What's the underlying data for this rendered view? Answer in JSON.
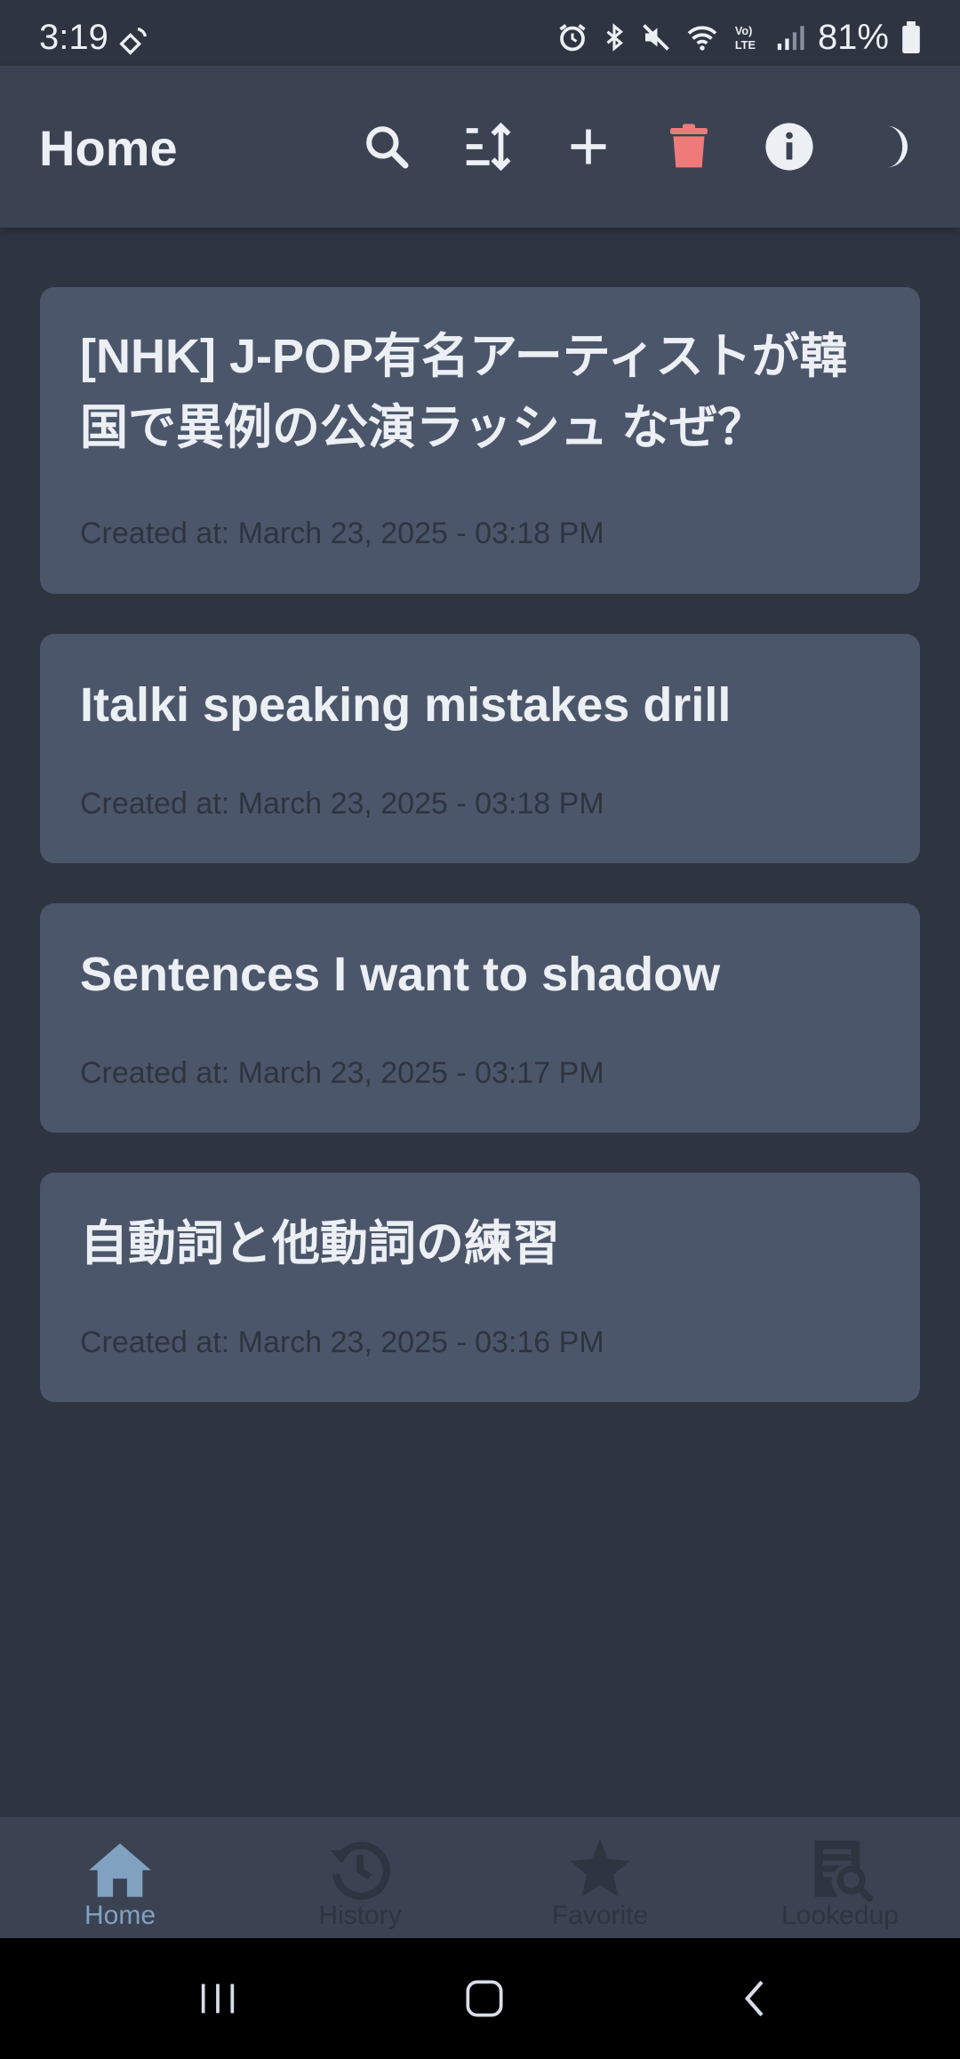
{
  "status_bar": {
    "time": "3:19",
    "battery": "81%",
    "icons": [
      "satellite-icon",
      "alarm-icon",
      "bluetooth-icon",
      "mute-icon",
      "wifi-icon",
      "volte-icon",
      "signal-icon",
      "battery-icon"
    ]
  },
  "app_bar": {
    "title": "Home",
    "actions": [
      "search-icon",
      "sort-icon",
      "add-icon",
      "delete-icon",
      "info-icon",
      "theme-moon-icon"
    ]
  },
  "notes": [
    {
      "title": "[NHK] J-POP有名アーティストが韓国で異例の公演ラッシュ なぜ？",
      "date": "Created at: March 23, 2025 - 03:18 PM"
    },
    {
      "title": "Italki speaking mistakes drill",
      "date": "Created at: March 23, 2025 - 03:18 PM"
    },
    {
      "title": "Sentences I want to shadow",
      "date": "Created at: March 23, 2025 - 03:17 PM"
    },
    {
      "title": "自動詞と他動詞の練習",
      "date": "Created at: March 23, 2025 - 03:16 PM"
    }
  ],
  "bottom_nav": [
    {
      "label": "Home",
      "icon": "home-icon",
      "active": true
    },
    {
      "label": "History",
      "icon": "history-icon",
      "active": false
    },
    {
      "label": "Favorite",
      "icon": "star-icon",
      "active": false
    },
    {
      "label": "Lookedup",
      "icon": "lookup-icon",
      "active": false
    }
  ],
  "colors": {
    "background": "#2e3440",
    "app_bar": "#3b4252",
    "card": "#4c566a",
    "text": "#eceff4",
    "date_text": "#2e3440",
    "accent": "#81a1c1",
    "delete": "#ef7a7a",
    "nav_inactive": "#2e3440"
  }
}
